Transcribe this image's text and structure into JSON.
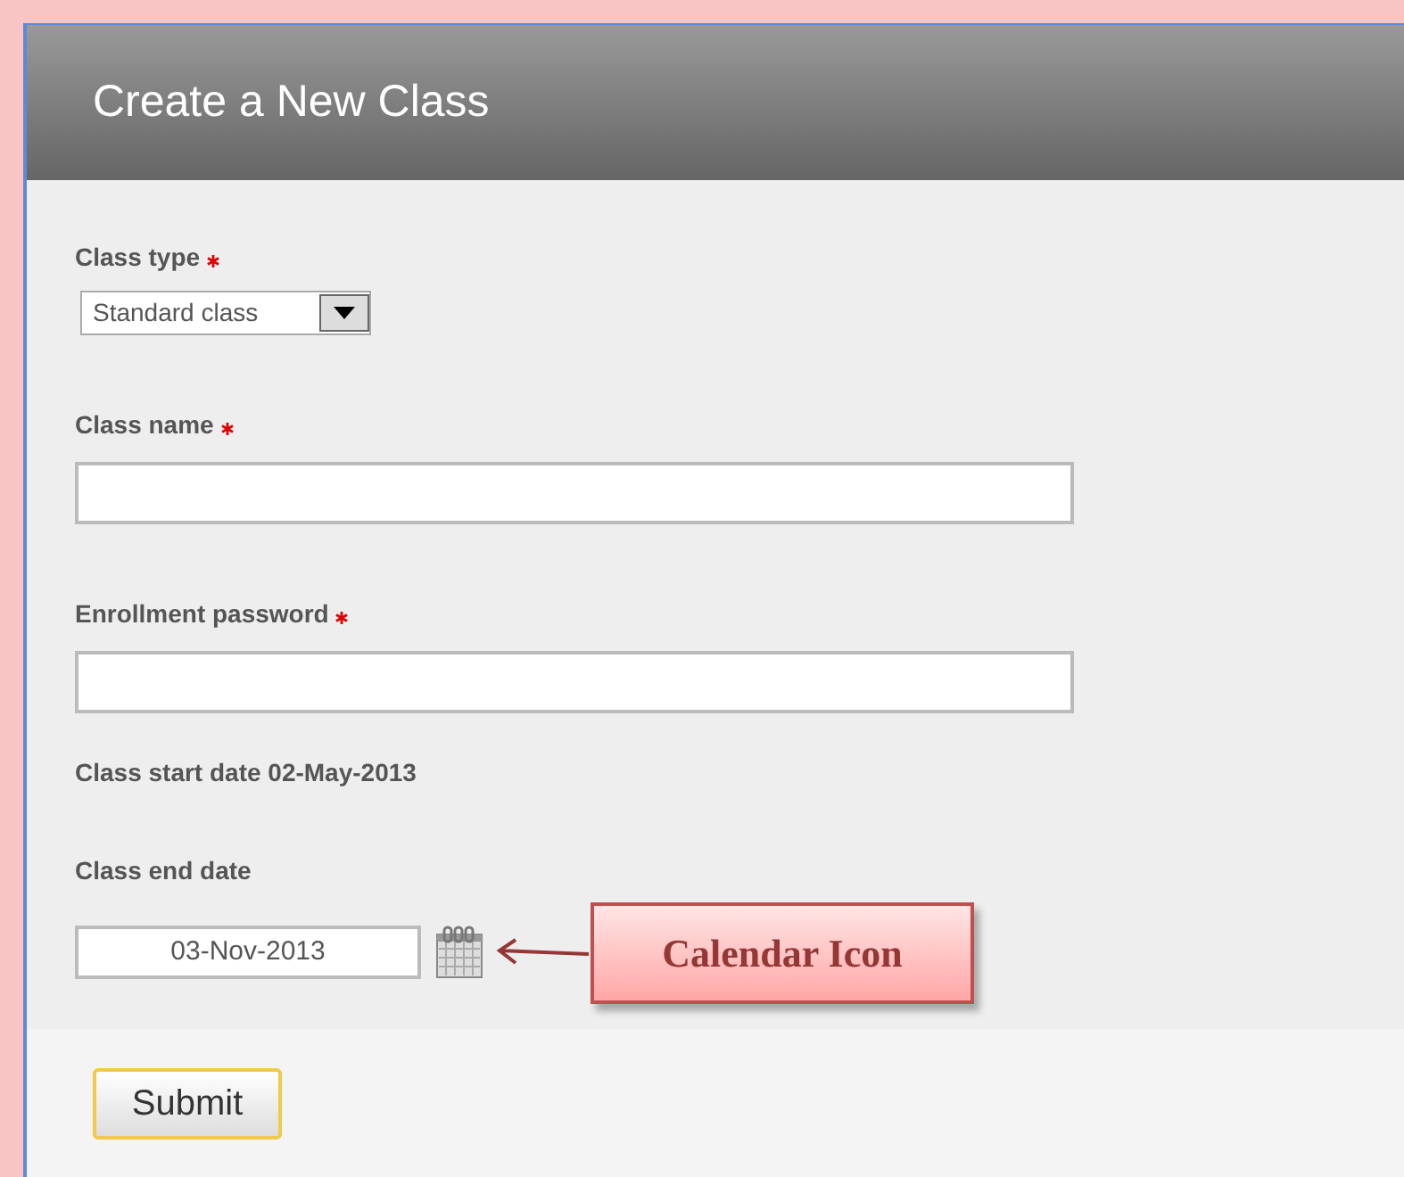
{
  "header": {
    "title": "Create a New Class"
  },
  "fields": [
    {
      "kind": "select",
      "label": "Class type",
      "required": true,
      "value": "Standard class"
    },
    {
      "kind": "text",
      "label": "Class name",
      "required": true
    },
    {
      "kind": "text",
      "label": "Enrollment password",
      "required": true
    },
    {
      "kind": "static",
      "label": "Class start date 02-May-2013"
    },
    {
      "kind": "date",
      "label": "Class end date",
      "required": false,
      "value": "03-Nov-2013"
    }
  ],
  "callout": {
    "text": "Calendar Icon"
  },
  "submit_button": "Submit"
}
